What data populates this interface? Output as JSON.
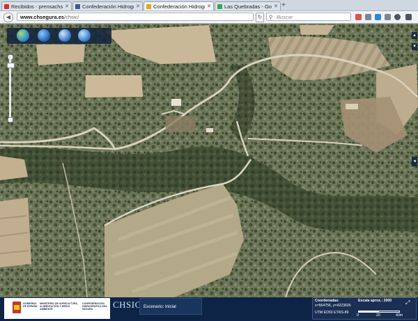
{
  "tabs": [
    {
      "label": "Recibidos - prensachsegur...",
      "favicon_color": "#d93025",
      "active": false
    },
    {
      "label": "Confederación Hidrográfic...",
      "favicon_color": "#3b5998",
      "active": false
    },
    {
      "label": "Confederación Hidrográfic...",
      "favicon_color": "#e6a817",
      "active": true
    },
    {
      "label": "Las Quebradas - Google M...",
      "favicon_color": "#34a853",
      "active": false
    }
  ],
  "new_tab_label": "+",
  "address": {
    "host": "www.chsegura.es",
    "path": "/chsic/"
  },
  "search": {
    "placeholder": "Buscar",
    "icon": "magnifier-icon"
  },
  "map": {
    "tools": [
      "globe-icon",
      "pen-icon",
      "binoculars-icon",
      "help-icon"
    ],
    "zoom_level": 0.12
  },
  "footer": {
    "gov_line1": "GOBIERNO",
    "gov_line2": "DE ESPAÑA",
    "ministry": "MINISTERIO DE AGRICULTURA, ALIMENTACIÓN Y MEDIO AMBIENTE",
    "confed": "CONFEDERACIÓN HIDROGRÁFICA DEL SEGURA",
    "brand": "CHSIC",
    "escenario_label": "Escenario: Inicial",
    "coords_title": "Coordenadas:",
    "coords_value": "x=564756, y=4223605",
    "projection": "UTM ED50 ETRS-89",
    "scale_title": "Escala aprox.: 2000",
    "scale_ticks": [
      "0",
      "20",
      "40m"
    ]
  },
  "colors": {
    "footer_bg": "#0d2446",
    "tool_panel_bg": "#14233c",
    "active_tab_bg": "#f4f6f8"
  }
}
